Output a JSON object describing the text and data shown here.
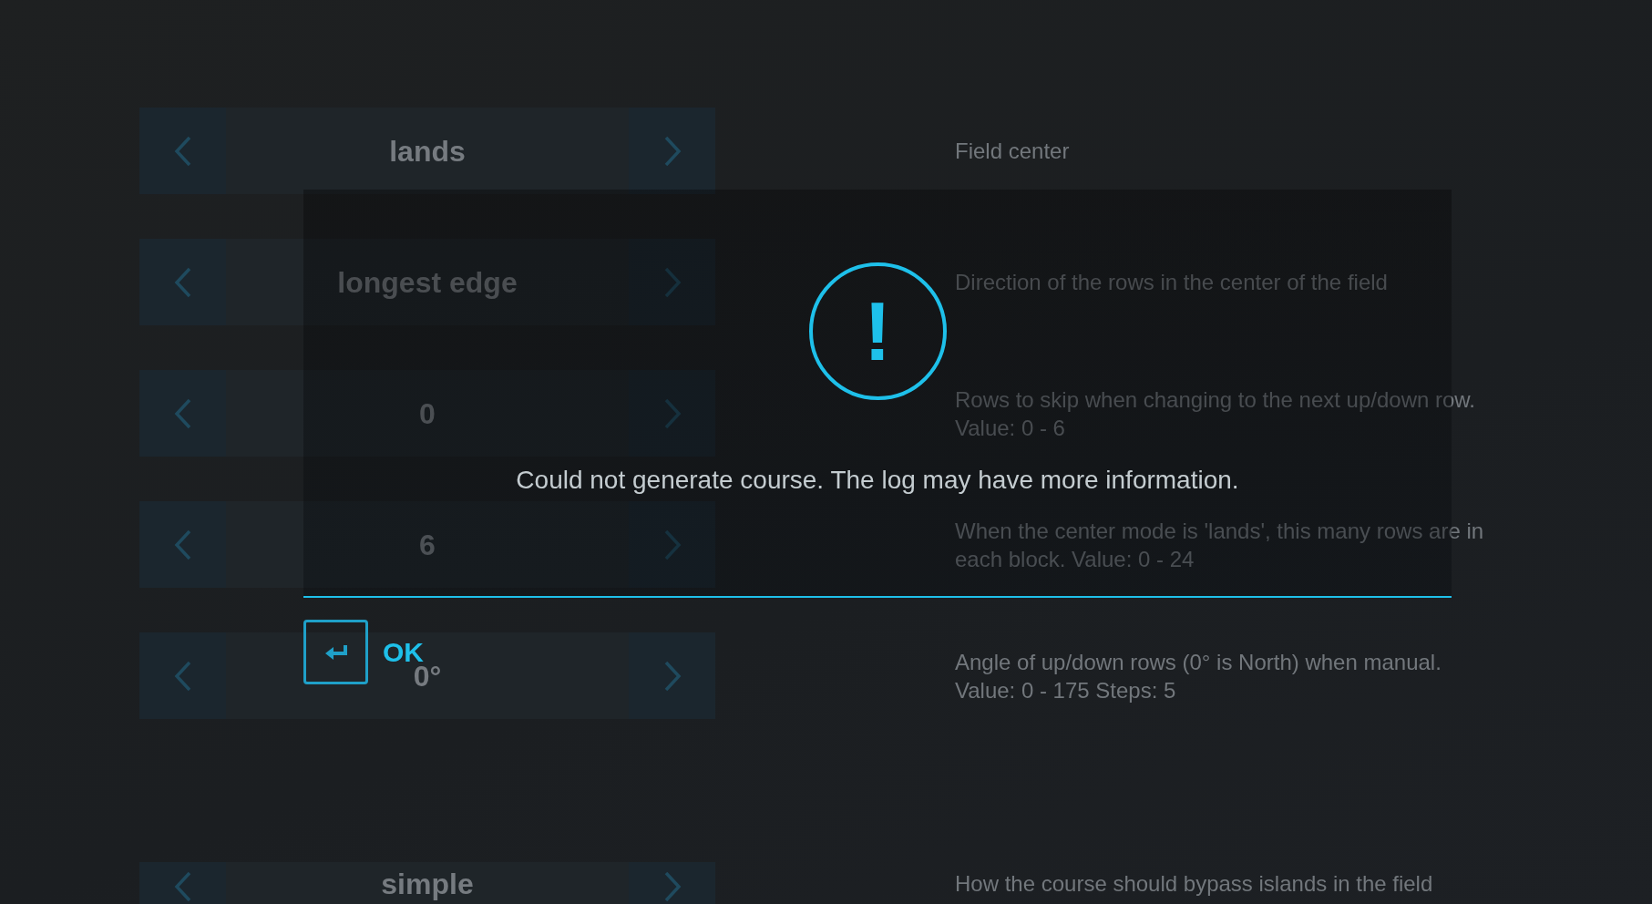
{
  "settings": [
    {
      "value": "lands",
      "description": "Field center"
    },
    {
      "value": "longest edge",
      "description": "Direction of the rows in the center of the field"
    },
    {
      "value": "0",
      "description": "Rows to skip when changing to the next up/down row. Value: 0 - 6"
    },
    {
      "value": "6",
      "description": "When the center mode is 'lands', this many rows are in each block. Value: 0 - 24"
    },
    {
      "value": "0°",
      "description": "Angle of up/down rows (0° is North) when manual. Value: 0 - 175 Steps: 5"
    },
    {
      "value": "simple",
      "description": "How the course should bypass islands in the field"
    }
  ],
  "dialog": {
    "message": "Could not generate course. The log may have more information.",
    "icon": "!",
    "button": "OK"
  }
}
